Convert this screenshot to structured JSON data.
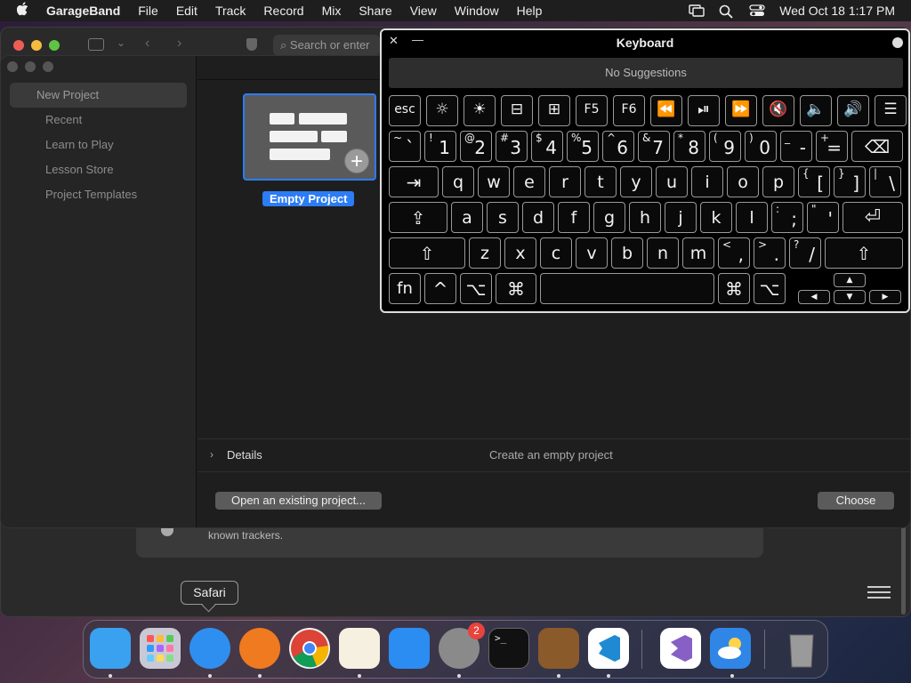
{
  "menubar": {
    "app": "GarageBand",
    "items": [
      "File",
      "Edit",
      "Track",
      "Record",
      "Mix",
      "Share",
      "View",
      "Window",
      "Help"
    ],
    "clock": "Wed Oct 18  1:17 PM"
  },
  "safari": {
    "address_placeholder": "Search or enter",
    "tracker_text": "known trackers."
  },
  "garageband": {
    "sidebar": [
      "New Project",
      "Recent",
      "Learn to Play",
      "Lesson Store",
      "Project Templates"
    ],
    "selected_item": "New Project",
    "template_label": "Empty Project",
    "details_label": "Details",
    "details_description": "Create an empty project",
    "open_button": "Open an existing project...",
    "choose_button": "Choose"
  },
  "keyboard": {
    "title": "Keyboard",
    "suggestions": "No Suggestions",
    "row_fn": [
      "esc",
      "☼",
      "☀",
      "⊟",
      "⊞",
      "F5",
      "F6",
      "⏪",
      "⏯",
      "⏩",
      "🔇",
      "🔈",
      "🔊",
      "☰"
    ],
    "row_num": [
      {
        "top": "~",
        "main": "`"
      },
      {
        "top": "!",
        "main": "1"
      },
      {
        "top": "@",
        "main": "2"
      },
      {
        "top": "#",
        "main": "3"
      },
      {
        "top": "$",
        "main": "4"
      },
      {
        "top": "%",
        "main": "5"
      },
      {
        "top": "^",
        "main": "6"
      },
      {
        "top": "&",
        "main": "7"
      },
      {
        "top": "*",
        "main": "8"
      },
      {
        "top": "(",
        "main": "9"
      },
      {
        "top": ")",
        "main": "0"
      },
      {
        "top": "_",
        "main": "-"
      },
      {
        "top": "+",
        "main": "="
      },
      {
        "top": "",
        "main": "⌫"
      }
    ],
    "row_q": [
      "⇥",
      "q",
      "w",
      "e",
      "r",
      "t",
      "y",
      "u",
      "i",
      "o",
      "p",
      "{ [",
      "} ]",
      "| \\"
    ],
    "row_a": [
      "⇪",
      "a",
      "s",
      "d",
      "f",
      "g",
      "h",
      "j",
      "k",
      "l",
      ": ;",
      "\" '",
      "⏎"
    ],
    "row_z": [
      "⇧",
      "z",
      "x",
      "c",
      "v",
      "b",
      "n",
      "m",
      "< ,",
      "> .",
      "? /",
      "⇧"
    ],
    "row_bottom": [
      "fn",
      "^",
      "⌥",
      "⌘",
      "",
      "⌘",
      "⌥"
    ],
    "arrows": [
      "▲",
      "◀",
      "▼",
      "▶"
    ]
  },
  "dock": {
    "tooltip": "Safari",
    "apps": [
      {
        "name": "Finder",
        "icon": "finder-icon",
        "color": "#3aa0f0"
      },
      {
        "name": "Launchpad",
        "icon": "launchpad-icon",
        "color": "#c9c9d6"
      },
      {
        "name": "Safari",
        "icon": "safari-icon",
        "color": "#2f8ff0"
      },
      {
        "name": "Firefox",
        "icon": "firefox-icon",
        "color": "#f07a1f"
      },
      {
        "name": "Chrome",
        "icon": "chrome-icon",
        "color": "#f2f2f2"
      },
      {
        "name": "TextEdit",
        "icon": "textedit-icon",
        "color": "#f5f0e0"
      },
      {
        "name": "App Store",
        "icon": "appstore-icon",
        "color": "#2b8cf2"
      },
      {
        "name": "System Settings",
        "icon": "settings-gear-icon",
        "color": "#8a8a8a",
        "badge": "2"
      },
      {
        "name": "Terminal",
        "icon": "terminal-icon",
        "color": "#111"
      },
      {
        "name": "GarageBand",
        "icon": "guitar-icon",
        "color": "#8a5a2a"
      },
      {
        "name": "VS Code",
        "icon": "vscode-icon",
        "color": "#fff"
      },
      {
        "name": "Visual Studio",
        "icon": "visualstudio-icon",
        "color": "#fff"
      },
      {
        "name": "Weather",
        "icon": "weather-icon",
        "color": "#2f86e6"
      },
      {
        "name": "Trash",
        "icon": "trash-icon",
        "color": "#888"
      }
    ]
  }
}
